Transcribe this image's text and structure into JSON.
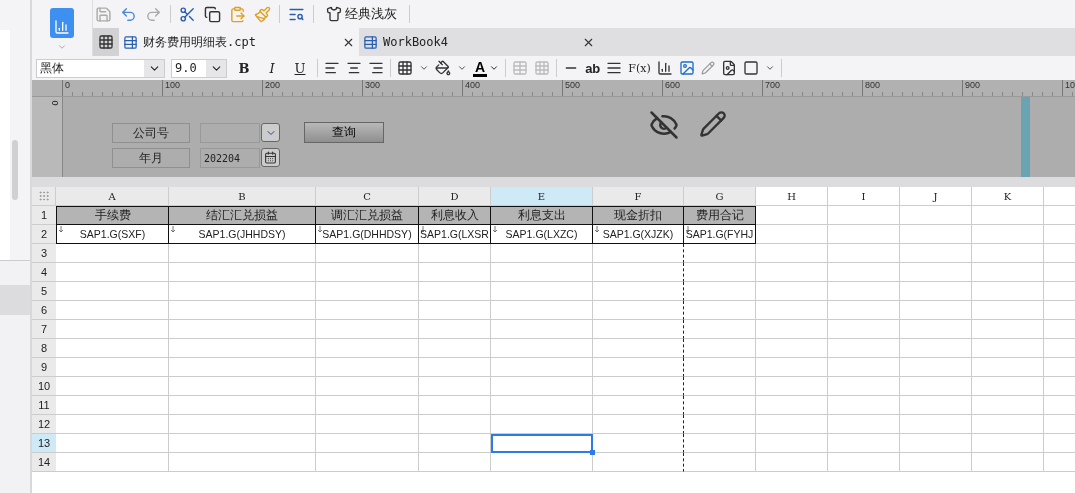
{
  "toolbar": {
    "theme_button": "经典浅灰"
  },
  "tabs": [
    {
      "label": "财务费用明细表.cpt",
      "selected": true
    },
    {
      "label": "WorkBook4",
      "selected": false
    }
  ],
  "format_bar": {
    "font": "黑体",
    "size": "9.0",
    "bold": "B",
    "italic": "I",
    "underline": "U",
    "font_color": "A",
    "text_tool": "ab",
    "formula_tool": "F(x)"
  },
  "ruler": {
    "labels": [
      "0",
      "100",
      "200",
      "300",
      "400",
      "500",
      "600",
      "700",
      "800",
      "900",
      "10"
    ],
    "vertical_label": "0"
  },
  "parameters": {
    "fields": [
      {
        "label": "公司号",
        "kind": "dropdown"
      },
      {
        "label": "年月",
        "value": "202204",
        "kind": "date"
      }
    ],
    "query_button": "查询"
  },
  "sheet": {
    "columns": [
      {
        "name": "A",
        "selected": false,
        "page_break": false
      },
      {
        "name": "B",
        "selected": false,
        "page_break": false
      },
      {
        "name": "C",
        "selected": false,
        "page_break": false
      },
      {
        "name": "D",
        "selected": false,
        "page_break": false
      },
      {
        "name": "E",
        "selected": true,
        "page_break": false
      },
      {
        "name": "F",
        "selected": false,
        "page_break": true
      },
      {
        "name": "G",
        "selected": false,
        "page_break": false
      },
      {
        "name": "H",
        "selected": false,
        "page_break": false
      },
      {
        "name": "I",
        "selected": false,
        "page_break": false
      },
      {
        "name": "J",
        "selected": false,
        "page_break": false
      },
      {
        "name": "K",
        "selected": false,
        "page_break": false
      }
    ],
    "rows": [
      {
        "number": "1",
        "kind": "header",
        "selected": false,
        "cells": [
          "手续费",
          "结汇汇兑损益",
          "调汇汇兑损益",
          "利息收入",
          "利息支出",
          "现金折扣",
          "费用合记"
        ]
      },
      {
        "number": "2",
        "kind": "formula",
        "selected": false,
        "cells": [
          "SAP1.G(SXF)",
          "SAP1.G(JHHDSY)",
          "SAP1.G(DHHDSY)",
          "SAP1.G(LXSR",
          "SAP1.G(LXZC)",
          "SAP1.G(XJZK)",
          "SAP1.G(FYHJ"
        ]
      },
      {
        "number": "3",
        "kind": "empty",
        "selected": false
      },
      {
        "number": "4",
        "kind": "empty",
        "selected": false
      },
      {
        "number": "5",
        "kind": "empty",
        "selected": false
      },
      {
        "number": "6",
        "kind": "empty",
        "selected": false
      },
      {
        "number": "7",
        "kind": "empty",
        "selected": false
      },
      {
        "number": "8",
        "kind": "empty",
        "selected": false
      },
      {
        "number": "9",
        "kind": "empty",
        "selected": false
      },
      {
        "number": "10",
        "kind": "empty",
        "selected": false
      },
      {
        "number": "11",
        "kind": "empty",
        "selected": false
      },
      {
        "number": "12",
        "kind": "empty",
        "selected": false
      },
      {
        "number": "13",
        "kind": "empty",
        "selected": true
      },
      {
        "number": "14",
        "kind": "empty",
        "selected": false
      }
    ]
  }
}
